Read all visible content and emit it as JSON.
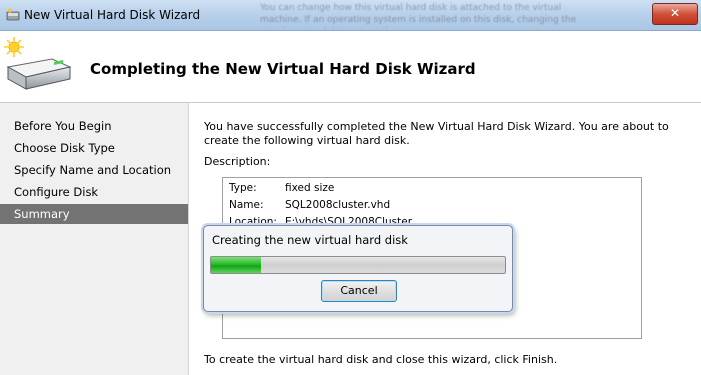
{
  "window": {
    "title": "New Virtual Hard Disk Wizard",
    "background_hint": "You can change how this virtual hard disk is attached to the virtual machine. If an operating system is installed on this disk, changing the attachment might prevent the",
    "close_label": "✕"
  },
  "header": {
    "heading": "Completing the New Virtual Hard Disk Wizard"
  },
  "nav": {
    "items": [
      {
        "label": "Before You Begin"
      },
      {
        "label": "Choose Disk Type"
      },
      {
        "label": "Specify Name and Location"
      },
      {
        "label": "Configure Disk"
      },
      {
        "label": "Summary",
        "active": true
      }
    ]
  },
  "content": {
    "intro": "You have successfully completed the New Virtual Hard Disk Wizard. You are about to create the following virtual hard disk.",
    "description_label": "Description:",
    "description": [
      {
        "key": "Type:",
        "value": "fixed size"
      },
      {
        "key": "Name:",
        "value": "SQL2008cluster.vhd"
      },
      {
        "key": "Location:",
        "value": "E:\\vhds\\SQL2008Cluster"
      }
    ],
    "finish_text": "To create the virtual hard disk and close this wizard, click Finish."
  },
  "progress": {
    "message": "Creating the new virtual hard disk",
    "value": 0.17,
    "cancel_label": "Cancel"
  },
  "colors": {
    "nav_active": "#737373",
    "progress_green": "#2dbb2d"
  }
}
